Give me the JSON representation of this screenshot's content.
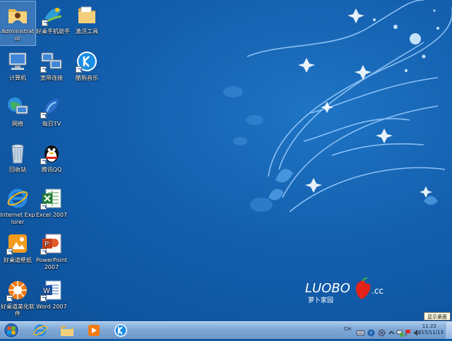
{
  "desktop": {
    "icons": [
      {
        "id": "administrator",
        "label": "Administrator",
        "icon": "user-folder-icon"
      },
      {
        "id": "haozhuo-phone",
        "label": "好桌手机助手",
        "icon": "phone-assistant-icon"
      },
      {
        "id": "activation-tool",
        "label": "激活工具",
        "icon": "folder-icon"
      },
      {
        "id": "computer",
        "label": "计算机",
        "icon": "computer-icon"
      },
      {
        "id": "broadband",
        "label": "宽带连接",
        "icon": "network-connection-icon"
      },
      {
        "id": "kugou",
        "label": "酷狗音乐",
        "icon": "kugou-music-icon"
      },
      {
        "id": "network",
        "label": "网络",
        "icon": "network-icon"
      },
      {
        "id": "meiri-tv",
        "label": "每日TV",
        "icon": "tv-icon"
      },
      {
        "id": "recycle-bin",
        "label": "回收站",
        "icon": "recycle-bin-icon"
      },
      {
        "id": "qq",
        "label": "腾讯QQ",
        "icon": "qq-penguin-icon"
      },
      {
        "id": "ie",
        "label": "Internet Explorer",
        "icon": "internet-explorer-icon"
      },
      {
        "id": "excel",
        "label": "Excel 2007",
        "icon": "excel-icon"
      },
      {
        "id": "haozhuo-wallpaper",
        "label": "好桌道壁纸",
        "icon": "wallpaper-app-icon"
      },
      {
        "id": "powerpoint",
        "label": "PowerPoint 2007",
        "icon": "powerpoint-icon"
      },
      {
        "id": "haozhuo-beautify",
        "label": "好桌道美化软件",
        "icon": "beautify-app-icon"
      },
      {
        "id": "word",
        "label": "Word 2007",
        "icon": "word-icon"
      }
    ]
  },
  "wallpaper": {
    "logo_text": "LUOBO",
    "logo_suffix": ".cc",
    "logo_subtitle": "萝卜家园"
  },
  "taskbar": {
    "pinned": [
      "internet-explorer-icon",
      "explorer-folder-icon",
      "media-player-icon",
      "kugou-music-icon"
    ],
    "tray": {
      "language": "CH",
      "time": "11:22",
      "date": "2015/11/13"
    },
    "show_desktop_tooltip": "显示桌面"
  },
  "colors": {
    "desktop_bg": "#135fae",
    "taskbar": "#7ea7d6"
  }
}
